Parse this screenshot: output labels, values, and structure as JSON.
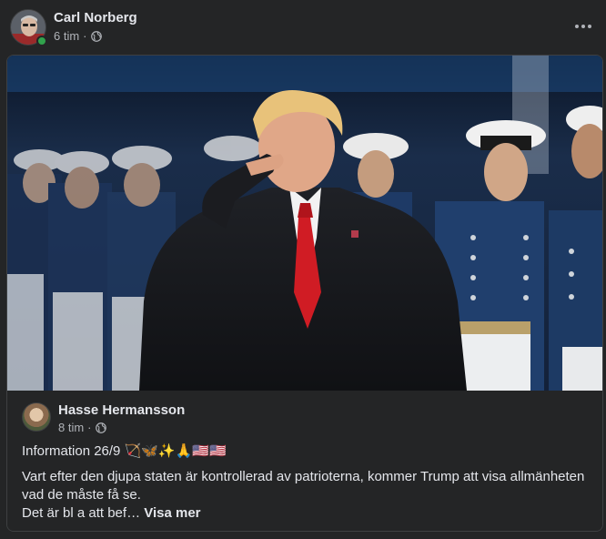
{
  "post": {
    "author": "Carl Norberg",
    "time": "6 tim",
    "separator": "·",
    "audience_icon": "globe-icon",
    "more_icon": "more-options-icon"
  },
  "shared": {
    "author": "Hasse Hermansson",
    "time": "8 tim",
    "separator": "·",
    "audience_icon": "globe-icon",
    "headline": "Information 26/9 🏹🦋✨🙏🇺🇸🇺🇸",
    "text_main": "Vart efter den djupa staten är kontrollerad av patrioterna, kommer Trump att visa allmänheten vad de måste få se.",
    "text_second": "Det är bl a att bef…",
    "see_more": "Visa mer"
  },
  "colors": {
    "background": "#242526",
    "primary_text": "#e4e6eb",
    "secondary_text": "#b0b3b8",
    "online": "#31a24c",
    "divider": "#3e4042"
  }
}
